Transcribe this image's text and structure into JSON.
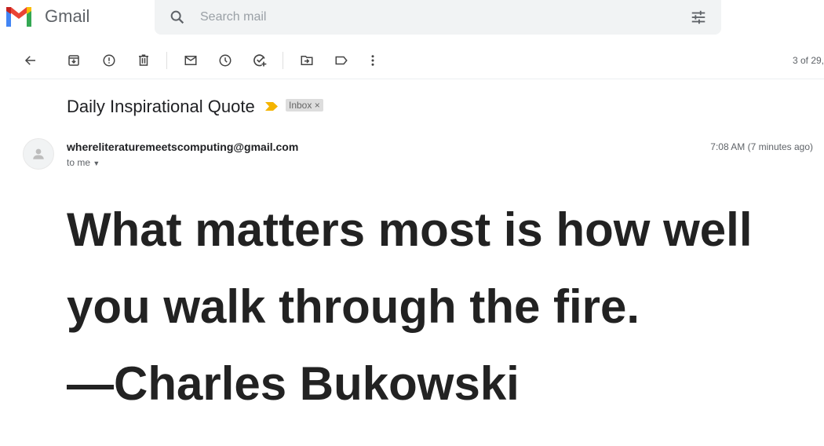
{
  "app": {
    "name": "Gmail"
  },
  "search": {
    "placeholder": "Search mail"
  },
  "toolbar": {
    "icons": [
      "back-icon",
      "archive-icon",
      "report-spam-icon",
      "delete-icon",
      "mark-unread-icon",
      "snooze-icon",
      "add-task-icon",
      "move-to-icon",
      "label-icon",
      "more-icon"
    ],
    "count": "3 of 29,"
  },
  "email": {
    "subject": "Daily Inspirational Quote",
    "label": "Inbox",
    "label_close": "×",
    "sender": "whereliteraturemeetscomputing@gmail.com",
    "recipient": "to me",
    "time": "7:08 AM (7 minutes ago)",
    "body_lines": [
      "What matters most is how well",
      "you walk through the fire.",
      "—Charles Bukowski"
    ]
  },
  "colors": {
    "importance_marker": "#f4b400",
    "search_bg": "#f1f3f4"
  }
}
